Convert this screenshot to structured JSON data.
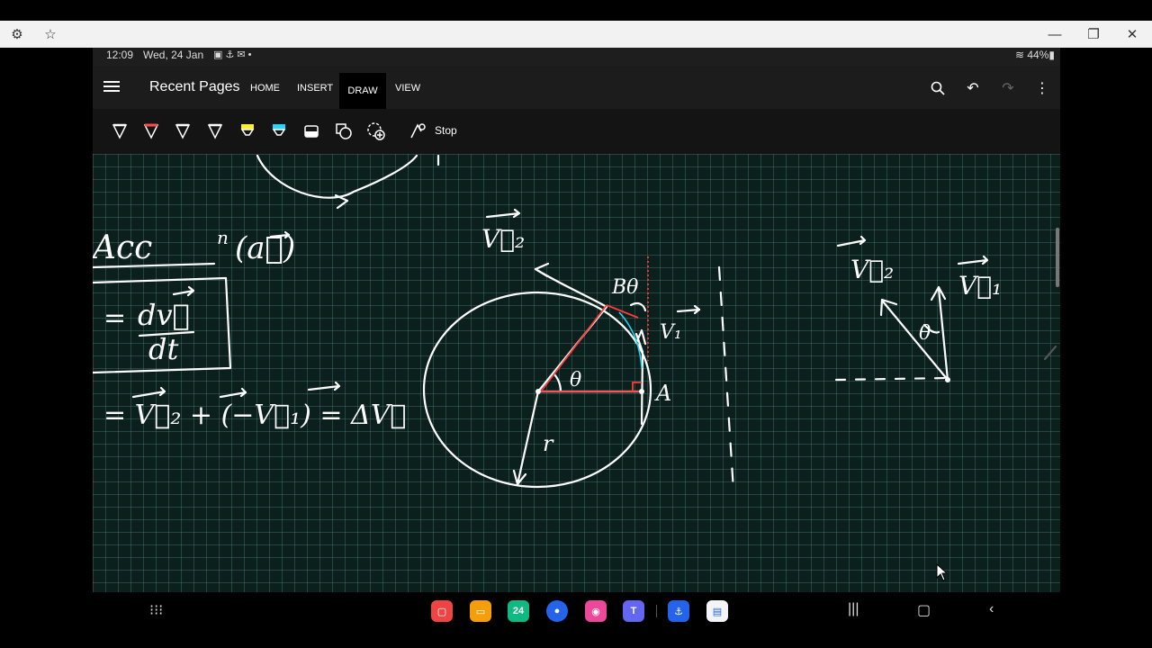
{
  "window": {
    "left_icons": [
      "gear-icon",
      "star-icon"
    ],
    "right_icons": [
      "minimize-icon",
      "restore-icon",
      "close-icon"
    ]
  },
  "status_bar": {
    "time": "12:09",
    "date": "Wed, 24 Jan",
    "battery": "44%"
  },
  "app_bar": {
    "title": "Recent Pages",
    "tabs": [
      "HOME",
      "INSERT",
      "DRAW",
      "VIEW"
    ],
    "active_tab": "DRAW"
  },
  "toolbar": {
    "stop_label": "Stop",
    "pen_colors": [
      "#ffffff",
      "#ff4d4d",
      "#ffffff",
      "#ffffff",
      "#ffee33",
      "#29d3ff"
    ]
  },
  "notes": {
    "accel_label": "Acc",
    "accel_sup": "n",
    "accel_paren": "(a⃗)",
    "formula_eq": "=",
    "formula_num": "dv⃗",
    "formula_den": "dt",
    "sum_expr": "= V⃗₂ + (−V⃗₁) = ΔV⃗",
    "label_v2_mid": "V⃗₂",
    "label_btheta": "Bθ",
    "label_v1_mid": "V₁",
    "label_theta": "θ",
    "label_A": "A",
    "label_r": "r",
    "label_v2_right": "V⃗₂",
    "label_v1_right": "V⃗₁",
    "label_theta_right": "θ"
  },
  "taskbar": {
    "apps": [
      "app-red",
      "app-folder",
      "calendar-24",
      "messages",
      "camera",
      "teams",
      "app-link",
      "app-chat"
    ],
    "calendar_day": "24"
  }
}
